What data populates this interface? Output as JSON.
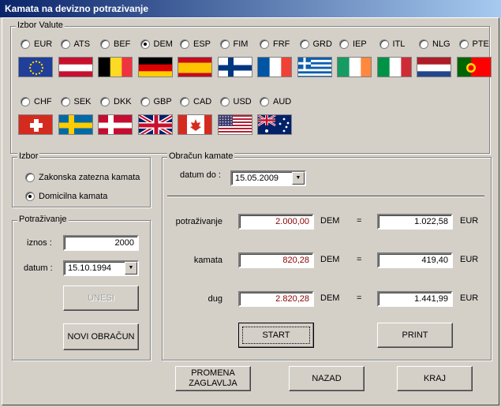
{
  "window": {
    "title": "Kamata na devizno potrazivanje"
  },
  "currency_group": {
    "legend": "Izbor Valute",
    "selected": "DEM",
    "row1": [
      "EUR",
      "ATS",
      "BEF",
      "DEM",
      "ESP",
      "FIM",
      "FRF",
      "GRD",
      "IEP",
      "ITL",
      "NLG",
      "PTE"
    ],
    "row2": [
      "CHF",
      "SEK",
      "DKK",
      "GBP",
      "CAD",
      "USD",
      "AUD"
    ]
  },
  "izbor_group": {
    "legend": "Izbor",
    "options": [
      "Zakonska zatezna kamata",
      "Domicilna kamata"
    ],
    "selected": "Domicilna kamata"
  },
  "potrazivanje_group": {
    "legend": "Potraživanje",
    "iznos_label": "iznos :",
    "iznos_value": "2000",
    "datum_label": "datum :",
    "datum_value": "15.10.1994",
    "unesi_label": "UNESI",
    "novi_label": "NOVI OBRAČUN"
  },
  "obracun_group": {
    "legend": "Obračun kamate",
    "datum_do_label": "datum do :",
    "datum_do_value": "15.05.2009",
    "rows": [
      {
        "label": "potraživanje",
        "value": "2.000,00",
        "currency": "DEM",
        "eq": "=",
        "converted": "1.022,58",
        "target": "EUR"
      },
      {
        "label": "kamata",
        "value": "820,28",
        "currency": "DEM",
        "eq": "=",
        "converted": "419,40",
        "target": "EUR"
      },
      {
        "label": "dug",
        "value": "2.820,28",
        "currency": "DEM",
        "eq": "=",
        "converted": "1.441,99",
        "target": "EUR"
      }
    ],
    "start_label": "START",
    "print_label": "PRINT"
  },
  "footer": {
    "promena_line1": "PROMENA",
    "promena_line2": "ZAGLAVLJA",
    "nazad_label": "NAZAD",
    "kraj_label": "KRAJ"
  }
}
